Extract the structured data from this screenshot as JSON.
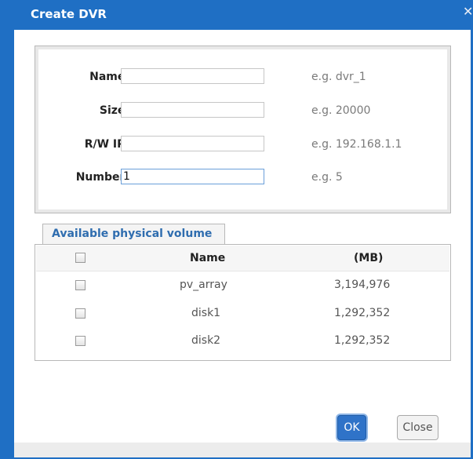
{
  "dialog": {
    "title": "Create DVR",
    "close_glyph": "✕"
  },
  "form": {
    "fields": [
      {
        "label": "Name:",
        "value": "",
        "hint": "e.g. dvr_1"
      },
      {
        "label": "Size:",
        "value": "",
        "hint": "e.g. 20000"
      },
      {
        "label": "R/W IP:",
        "value": "",
        "hint": "e.g. 192.168.1.1"
      },
      {
        "label": "Number:",
        "value": "1",
        "hint": "e.g. 5"
      }
    ]
  },
  "volume_tab": {
    "label": "Available physical volume"
  },
  "table": {
    "columns": [
      "Name",
      "(MB)"
    ],
    "rows": [
      {
        "name": "pv_array",
        "size": "3,194,976"
      },
      {
        "name": "disk1",
        "size": "1,292,352"
      },
      {
        "name": "disk2",
        "size": "1,292,352"
      }
    ]
  },
  "buttons": {
    "ok": "OK",
    "close": "Close"
  },
  "colors": {
    "accent": "#1f6fc4",
    "tab_text": "#2f6daf",
    "ok_button": "#2f73c8"
  },
  "icons": {
    "close": "close-icon",
    "checkbox": "checkbox-icon"
  }
}
